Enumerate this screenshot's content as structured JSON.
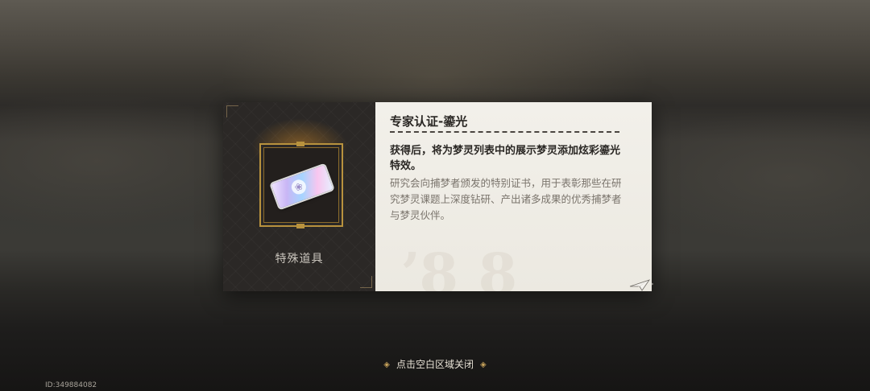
{
  "item": {
    "title": "专家认证-鎏光",
    "type": "特殊道具",
    "effect": "获得后，将为梦灵列表中的展示梦灵添加炫彩鎏光特效。",
    "description": "研究会向捕梦者颁发的特别证书，用于表彰那些在研究梦灵课题上深度钻研、产出诸多成果的优秀捕梦者与梦灵伙伴。",
    "icon": "certificate-card-icon"
  },
  "footer": {
    "close_hint": "点击空白区域关闭",
    "uid": "ID:349884082"
  },
  "colors": {
    "gold": "#b8923e",
    "dark_panel": "#2b2826",
    "light_panel": "#f2f0ea"
  }
}
